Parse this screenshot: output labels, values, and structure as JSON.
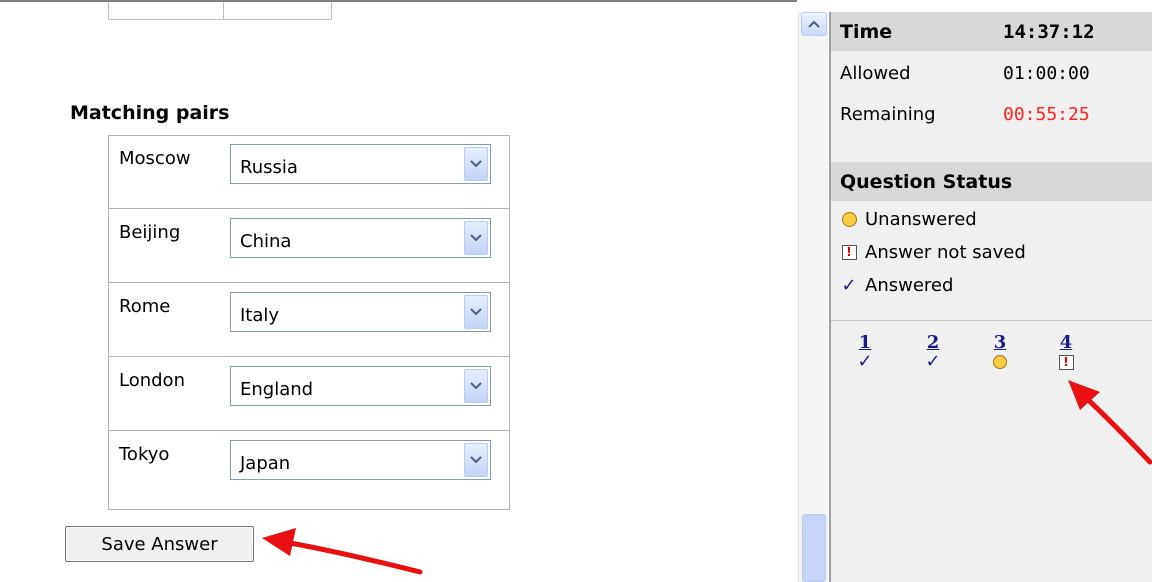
{
  "quiz": {
    "section_title": "Matching pairs",
    "pairs": [
      {
        "label": "Moscow",
        "answer": "Russia"
      },
      {
        "label": "Beijing",
        "answer": "China"
      },
      {
        "label": "Rome",
        "answer": "Italy"
      },
      {
        "label": "London",
        "answer": "England"
      },
      {
        "label": "Tokyo",
        "answer": "Japan"
      }
    ],
    "save_label": "Save Answer"
  },
  "timer": {
    "label": "Time",
    "current": "14:37:12",
    "allowed_label": "Allowed",
    "allowed": "01:00:00",
    "remaining_label": "Remaining",
    "remaining": "00:55:25"
  },
  "status": {
    "title": "Question Status",
    "legend": [
      {
        "icon": "circle-icon",
        "label": "Unanswered"
      },
      {
        "icon": "answer-not-saved-icon",
        "label": "Answer not saved"
      },
      {
        "icon": "checkmark-icon",
        "label": "Answered"
      }
    ],
    "questions": [
      {
        "number": "1",
        "state": "answered"
      },
      {
        "number": "2",
        "state": "answered"
      },
      {
        "number": "3",
        "state": "unanswered"
      },
      {
        "number": "4",
        "state": "not-saved"
      }
    ]
  },
  "colors": {
    "remaining": "#ff2020",
    "annotation_arrow": "#e81010",
    "link": "#1a1a8c"
  }
}
